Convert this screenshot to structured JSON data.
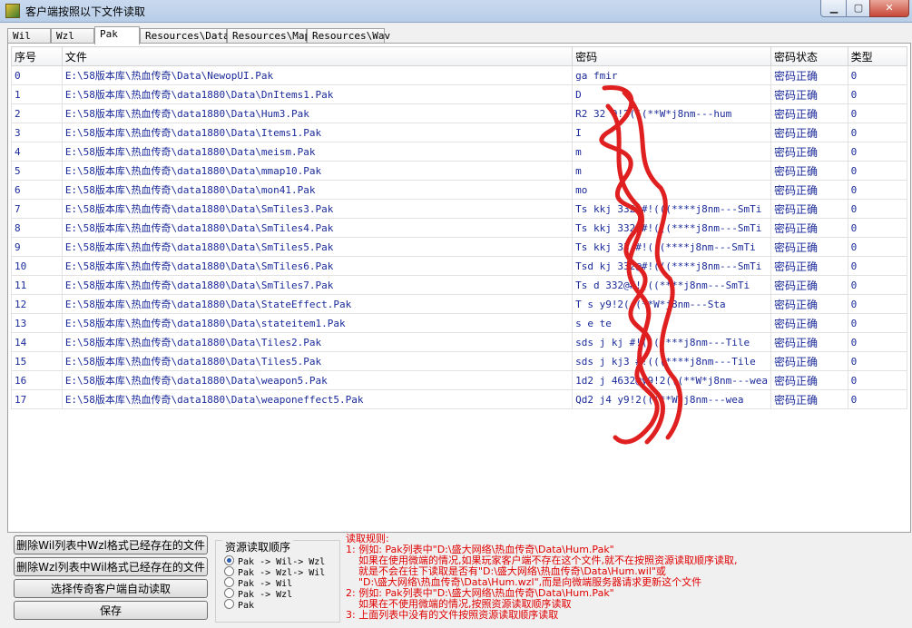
{
  "window": {
    "title": "客户端按照以下文件读取"
  },
  "tabs": [
    "Wil",
    "Wzl",
    "Pak",
    "Resources\\Data",
    "Resources\\Map",
    "Resources\\Wav"
  ],
  "active_tab": "Pak",
  "table": {
    "columns": [
      "序号",
      "文件",
      "密码",
      "密码状态",
      "类型"
    ],
    "rows": [
      [
        "0",
        "E:\\58版本库\\热血传奇\\Data\\NewopUI.Pak",
        "ga   fmir",
        "密码正确",
        "0"
      ],
      [
        "1",
        "E:\\58版本库\\热血传奇\\data1880\\Data\\DnItems1.Pak",
        "D",
        "密码正确",
        "0"
      ],
      [
        "2",
        "E:\\58版本库\\热血传奇\\data1880\\Data\\Hum3.Pak",
        "R2   32  9!2(((**W*j8nm---hum",
        "密码正确",
        "0"
      ],
      [
        "3",
        "E:\\58版本库\\热血传奇\\data1880\\Data\\Items1.Pak",
        "I",
        "密码正确",
        "0"
      ],
      [
        "4",
        "E:\\58版本库\\热血传奇\\data1880\\Data\\meism.Pak",
        "m",
        "密码正确",
        "0"
      ],
      [
        "5",
        "E:\\58版本库\\热血传奇\\data1880\\Data\\mmap10.Pak",
        "m",
        "密码正确",
        "0"
      ],
      [
        "6",
        "E:\\58版本库\\热血传奇\\data1880\\Data\\mon41.Pak",
        "mo",
        "密码正确",
        "0"
      ],
      [
        "7",
        "E:\\58版本库\\热血传奇\\data1880\\Data\\SmTiles3.Pak",
        "Ts   kkj  332@#!(((****j8nm---SmTi",
        "密码正确",
        "0"
      ],
      [
        "8",
        "E:\\58版本库\\热血传奇\\data1880\\Data\\SmTiles4.Pak",
        "Ts   kkj  332@#!(((****j8nm---SmTi",
        "密码正确",
        "0"
      ],
      [
        "9",
        "E:\\58版本库\\热血传奇\\data1880\\Data\\SmTiles5.Pak",
        "Ts   kkj  33  #!(((****j8nm---SmTi",
        "密码正确",
        "0"
      ],
      [
        "10",
        "E:\\58版本库\\热血传奇\\data1880\\Data\\SmTiles6.Pak",
        "Tsd   kj  332@#!(((****j8nm---SmTi",
        "密码正确",
        "0"
      ],
      [
        "11",
        "E:\\58版本库\\热血传奇\\data1880\\Data\\SmTiles7.Pak",
        "Ts   d   332@#!(((****j8nm---SmTi",
        "密码正确",
        "0"
      ],
      [
        "12",
        "E:\\58版本库\\热血传奇\\data1880\\Data\\StateEffect.Pak",
        "T    s   y9!2(((**W*j8nm---Sta",
        "密码正确",
        "0"
      ],
      [
        "13",
        "E:\\58版本库\\热血传奇\\data1880\\Data\\stateitem1.Pak",
        "s  e  te",
        "密码正确",
        "0"
      ],
      [
        "14",
        "E:\\58版本库\\热血传奇\\data1880\\Data\\Tiles2.Pak",
        "sds  j  kj   #!(((****j8nm---Tile",
        "密码正确",
        "0"
      ],
      [
        "15",
        "E:\\58版本库\\热血传奇\\data1880\\Data\\Tiles5.Pak",
        "sds  j  kj3   #!(((****j8nm---Tile",
        "密码正确",
        "0"
      ],
      [
        "16",
        "E:\\58版本库\\热血传奇\\data1880\\Data\\weapon5.Pak",
        "1d2  j  4632@y9!2(((**W*j8nm---wea",
        "密码正确",
        "0"
      ],
      [
        "17",
        "E:\\58版本库\\热血传奇\\data1880\\Data\\weaponeffect5.Pak",
        "Qd2   j4   y9!2(((**W*j8nm---wea",
        "密码正确",
        "0"
      ]
    ]
  },
  "buttons": {
    "delete_wil": "删除Wil列表中Wzl格式已经存在的文件",
    "delete_wzl": "删除Wzl列表中Wil格式已经存在的文件",
    "auto_read": "选择传奇客户端自动读取",
    "save": "保存"
  },
  "read_order": {
    "title": "资源读取顺序",
    "options": [
      "Pak -> Wil-> Wzl",
      "Pak -> Wzl-> Wil",
      "Pak -> Wil",
      "Pak -> Wzl",
      "Pak"
    ],
    "selected_index": 0
  },
  "rules": [
    "读取规则:",
    "1: 例如: Pak列表中\"D:\\盛大网络\\热血传奇\\Data\\Hum.Pak\"",
    "    如果在使用微端的情况,如果玩家客户端不存在这个文件,就不在按照资源读取顺序读取,",
    "    就是不会在往下读取是否有\"D:\\盛大网络\\热血传奇\\Data\\Hum.wil\"或",
    "    \"D:\\盛大网络\\热血传奇\\Data\\Hum.wzl\",而是向微端服务器请求更新这个文件",
    "2: 例如: Pak列表中\"D:\\盛大网络\\热血传奇\\Data\\Hum.Pak\"",
    "    如果在不使用微端的情况,按照资源读取顺序读取",
    "3: 上面列表中没有的文件按照资源读取顺序读取"
  ],
  "colors": {
    "link_text": "#1a2a9a",
    "rules_text": "#e00000",
    "scribble": "#e02020"
  }
}
